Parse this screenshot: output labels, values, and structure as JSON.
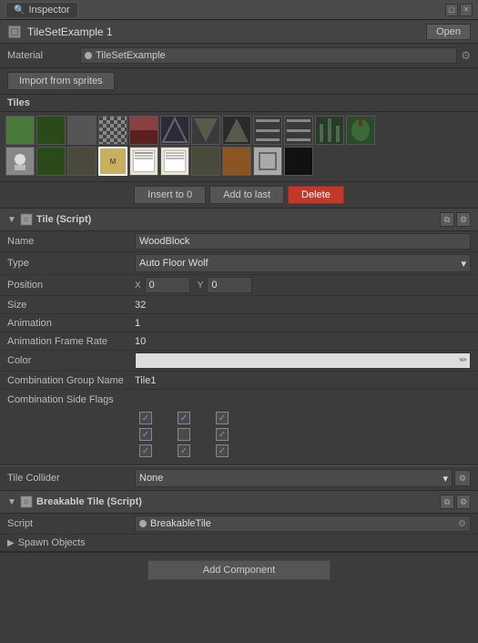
{
  "titleBar": {
    "tabLabel": "Inspector",
    "winBtns": [
      "▢",
      "✕"
    ]
  },
  "objectHeader": {
    "name": "TileSetExample 1",
    "openBtn": "Open"
  },
  "material": {
    "label": "Material",
    "value": "TileSetExample",
    "settingsIcon": "⚙"
  },
  "importBtn": "Import from sprites",
  "tilesHeader": "Tiles",
  "tileActions": {
    "insertTo0": "Insert to 0",
    "addToLast": "Add to last",
    "delete": "Delete"
  },
  "tileScript": {
    "componentTitle": "Tile (Script)",
    "copyIcon": "⧉",
    "settingsIcon": "⚙",
    "fields": {
      "name": {
        "label": "Name",
        "value": "WoodBlock"
      },
      "type": {
        "label": "Type",
        "value": "Auto Floor Wolf"
      },
      "positionX": {
        "label": "X",
        "value": "0"
      },
      "positionY": {
        "label": "Y",
        "value": "0"
      },
      "size": {
        "label": "Size",
        "value": "32"
      },
      "animation": {
        "label": "Animation",
        "value": "1"
      },
      "animationFrameRate": {
        "label": "Animation Frame Rate",
        "value": "10"
      },
      "color": {
        "label": "Color",
        "value": ""
      },
      "combinationGroupName": {
        "label": "Combination Group Name",
        "value": "Tile1"
      },
      "combinationSideFlags": {
        "label": "Combination Side Flags",
        "value": ""
      }
    },
    "checkboxRows": [
      [
        true,
        true,
        true
      ],
      [
        true,
        false,
        true
      ],
      [
        true,
        true,
        true
      ]
    ]
  },
  "tileCollider": {
    "label": "Tile Collider",
    "value": "None",
    "dropdownArrow": "▾",
    "settingsIcon": "⚙"
  },
  "breakableTile": {
    "componentTitle": "Breakable Tile (Script)",
    "copyIcon": "⧉",
    "settingsIcon": "⚙",
    "scriptLabel": "Script",
    "scriptValue": "BreakableTile",
    "scriptDot": "●",
    "spawnLabel": "Spawn Objects",
    "spawnArrow": "▶"
  },
  "addComponent": {
    "label": "Add Component"
  }
}
